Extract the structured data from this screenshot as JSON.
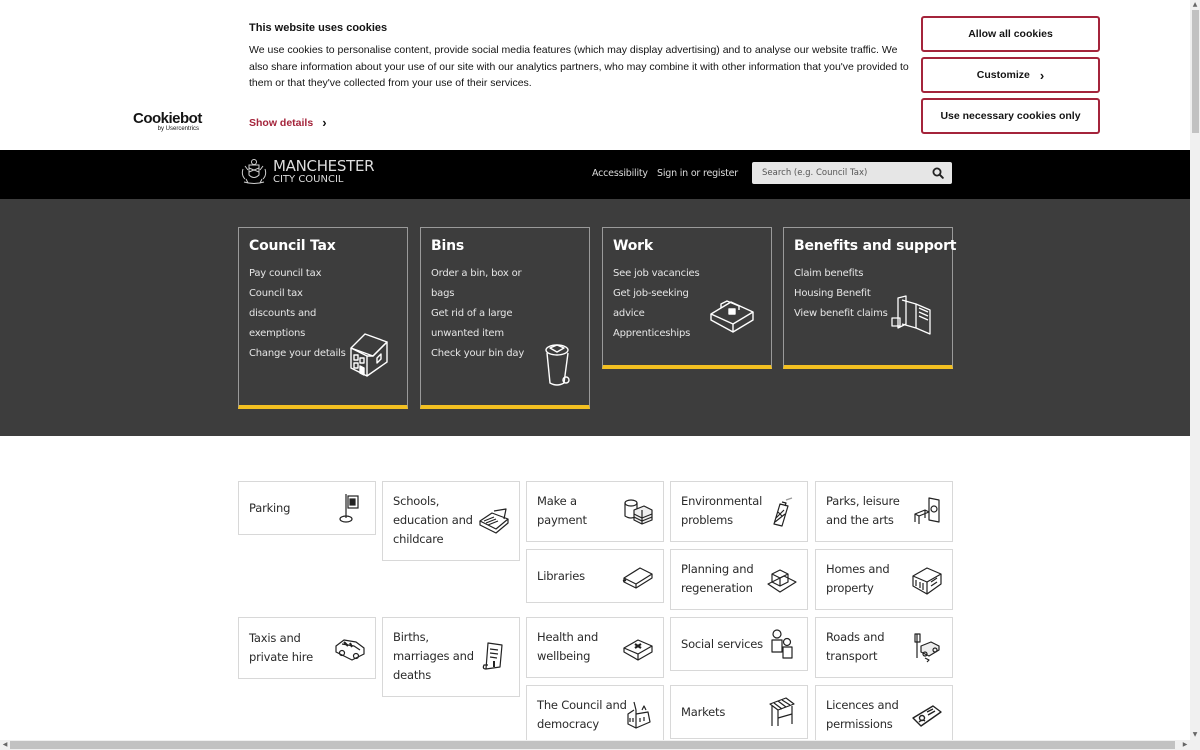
{
  "cookie_banner": {
    "logo_brand": "Cookiebot",
    "logo_sub": "by Usercentrics",
    "title": "This website uses cookies",
    "text": "We use cookies to personalise content, provide social media features (which may display advertising) and to analyse our website traffic. We also share information about your use of our site with our analytics partners, who may combine it with other information that you've provided to them or that they've collected from your use of their services.",
    "show_details_label": "Show details",
    "allow_all_label": "Allow all cookies",
    "customize_label": "Customize",
    "necessary_only_label": "Use necessary cookies only",
    "accent_color": "#a4243b"
  },
  "header": {
    "logo_line1": "MANCHESTER",
    "logo_line2": "CITY COUNCIL",
    "nav": [
      {
        "label": "Accessibility"
      },
      {
        "label": "Sign in or register"
      }
    ],
    "search_placeholder": "Search (e.g. Council Tax)"
  },
  "featured": [
    {
      "title": "Council Tax",
      "icon": "house-icon",
      "links": [
        "Pay council tax",
        "Council tax discounts and exemptions",
        "Change your details"
      ]
    },
    {
      "title": "Bins",
      "icon": "wheelie-bin-icon",
      "links": [
        "Order a bin, box or bags",
        "Get rid of a large unwanted item",
        "Check your bin day"
      ]
    },
    {
      "title": "Work",
      "icon": "briefcase-icon",
      "links": [
        "See job vacancies",
        "Get job-seeking advice",
        "Apprenticeships"
      ]
    },
    {
      "title": "Benefits and support",
      "icon": "wallet-icon",
      "links": [
        "Claim benefits",
        "Housing Benefit",
        "View benefit claims"
      ]
    }
  ],
  "featured_accent_color": "#f3c021",
  "services": [
    {
      "label": "Parking",
      "icon": "parking-sign-icon"
    },
    {
      "label": "Schools, education and childcare",
      "icon": "school-books-icon"
    },
    {
      "label": "Make a payment",
      "icon": "coins-cash-icon"
    },
    {
      "label": "Environmental problems",
      "icon": "spray-can-icon"
    },
    {
      "label": "Parks, leisure and the arts",
      "icon": "park-bench-icon"
    },
    {
      "label": "Libraries",
      "icon": "book-icon"
    },
    {
      "label": "Planning and regeneration",
      "icon": "building-plan-icon"
    },
    {
      "label": "Homes and property",
      "icon": "terraced-houses-icon"
    },
    {
      "label": "Taxis and private hire",
      "icon": "taxi-icon"
    },
    {
      "label": "Births, marriages and deaths",
      "icon": "scroll-certificate-icon"
    },
    {
      "label": "Health and wellbeing",
      "icon": "first-aid-kit-icon"
    },
    {
      "label": "Social services",
      "icon": "people-icon"
    },
    {
      "label": "Roads and transport",
      "icon": "traffic-car-icon"
    },
    {
      "label": "The Council and democracy",
      "icon": "town-hall-icon"
    },
    {
      "label": "Markets",
      "icon": "market-stall-icon"
    },
    {
      "label": "Licences and permissions",
      "icon": "id-card-icon"
    }
  ]
}
